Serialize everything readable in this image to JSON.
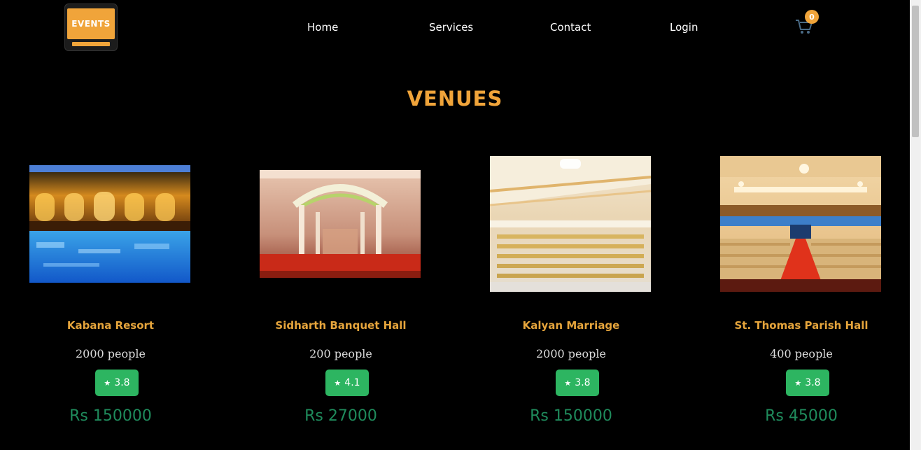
{
  "header": {
    "logo": {
      "text": "EVENTS",
      "color": "#f0a43a"
    },
    "nav": {
      "home": "Home",
      "services": "Services",
      "contact": "Contact",
      "login": "Login"
    },
    "cart": {
      "icon": "cart-icon",
      "count": "0"
    }
  },
  "main": {
    "title": "VENUES",
    "accent_color": "#f0a43a",
    "rating_color": "#2db561",
    "venues": [
      {
        "name": "Kabana Resort",
        "capacity": "2000 people",
        "rating": "3.8",
        "price": "Rs 150000",
        "image": "resort-pool-photo"
      },
      {
        "name": "Sidharth Banquet Hall",
        "capacity": "200 people",
        "rating": "4.1",
        "price": "Rs 27000",
        "image": "wedding-mandap-photo"
      },
      {
        "name": "Kalyan Marriage",
        "capacity": "2000 people",
        "rating": "3.8",
        "price": "Rs 150000",
        "image": "marriage-hall-photo"
      },
      {
        "name": "St. Thomas Parish Hall",
        "capacity": "400 people",
        "rating": "3.8",
        "price": "Rs 45000",
        "image": "parish-hall-photo"
      }
    ]
  }
}
